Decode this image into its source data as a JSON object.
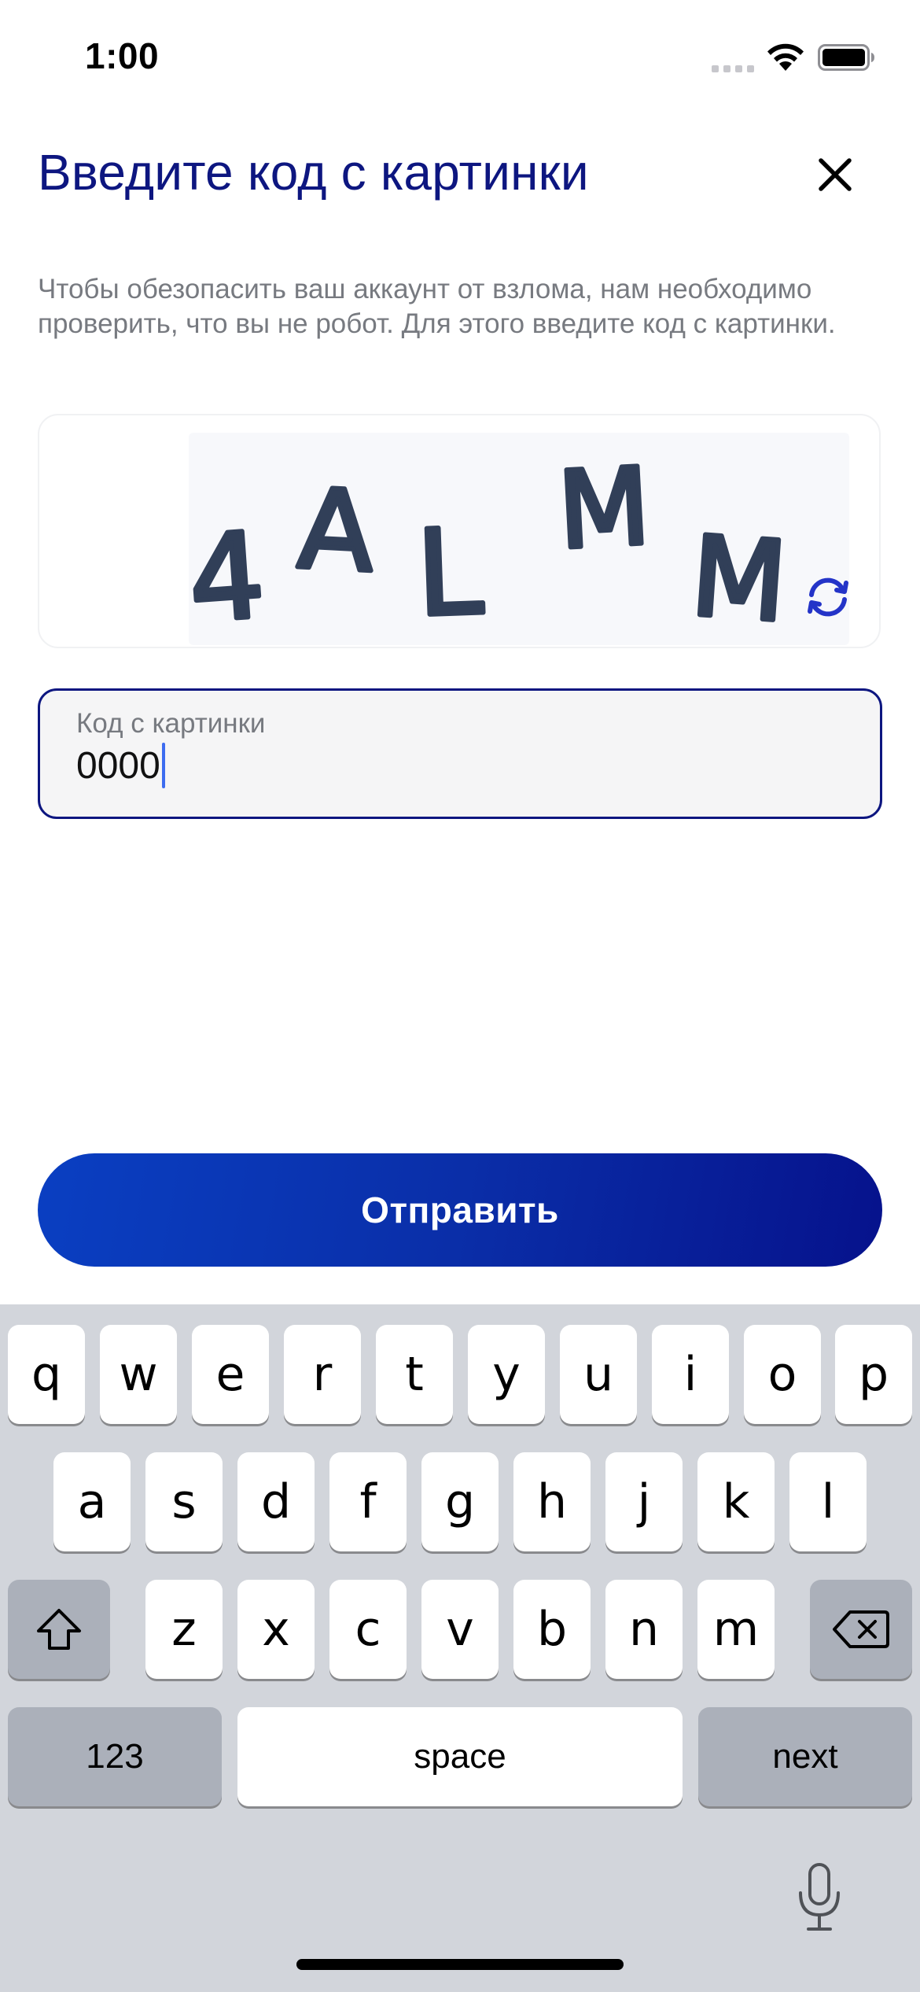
{
  "status_bar": {
    "time": "1:00",
    "icons": [
      "cellular-signal-icon",
      "wifi-icon",
      "battery-icon"
    ]
  },
  "header": {
    "title": "Введите код с картинки",
    "close_icon": "close-icon"
  },
  "description": "Чтобы обезопасить ваш аккаунт от взлома, нам необходимо проверить, что вы не робот. Для этого введите код с картинки.",
  "captcha": {
    "characters": [
      "4",
      "A",
      "L",
      "M",
      "M"
    ],
    "refresh_icon": "refresh-icon"
  },
  "code_input": {
    "label": "Код с картинки",
    "value": "0000"
  },
  "submit_button": {
    "label": "Отправить"
  },
  "keyboard": {
    "row1": [
      "q",
      "w",
      "e",
      "r",
      "t",
      "y",
      "u",
      "i",
      "o",
      "p"
    ],
    "row2": [
      "a",
      "s",
      "d",
      "f",
      "g",
      "h",
      "j",
      "k",
      "l"
    ],
    "row3": [
      "z",
      "x",
      "c",
      "v",
      "b",
      "n",
      "m"
    ],
    "numbers_key": "123",
    "space_key": "space",
    "next_key": "next"
  },
  "colors": {
    "title": "#0d1680",
    "accent": "#0a3fc2",
    "input_border": "#0d1680",
    "caret": "#3d6cf0",
    "keyboard_bg": "#d2d5db"
  }
}
